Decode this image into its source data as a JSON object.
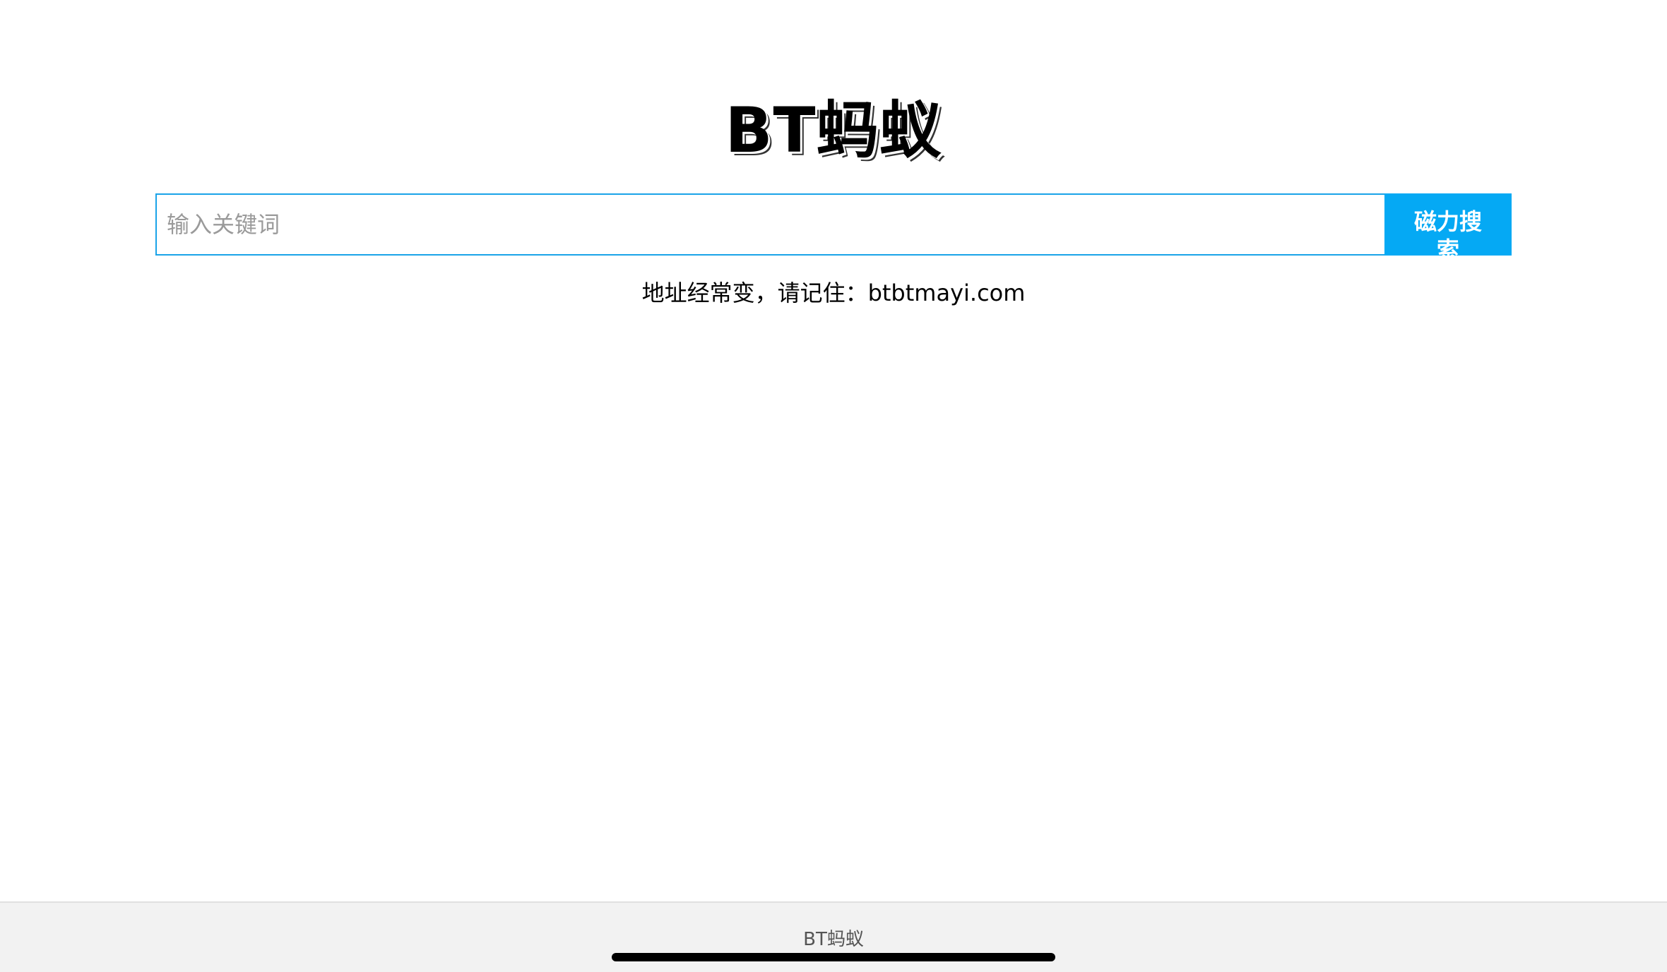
{
  "header": {
    "site_title": "BT蚂蚁"
  },
  "search": {
    "placeholder": "输入关键词",
    "value": "",
    "button_label": "磁力搜索"
  },
  "notice": {
    "text": "地址经常变，请记住：btbtmayi.com"
  },
  "footer": {
    "text": "BT蚂蚁"
  },
  "colors": {
    "accent": "#05a9f4",
    "input_border": "#1aa3e8",
    "footer_bg": "#f2f2f2"
  }
}
